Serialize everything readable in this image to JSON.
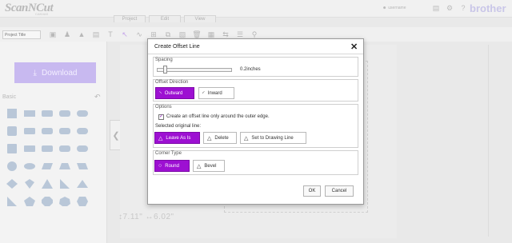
{
  "app": {
    "logo_text": "ScanNCut",
    "logo_sub": "CANVAS",
    "brand": "brother",
    "user_name": "username"
  },
  "tabs": [
    {
      "label": "Project"
    },
    {
      "label": "Edit"
    },
    {
      "label": "View"
    }
  ],
  "toolbar": {
    "project_title_placeholder": "Project Title",
    "icons": [
      "save-icon",
      "person-icon",
      "stamp-icon",
      "image-icon",
      "text-icon",
      "select-cursor-icon",
      "line-tool-icon",
      "crop-icon",
      "copy-icon",
      "paste-icon",
      "delete-icon",
      "grid-icon",
      "flip-icon",
      "layer-icon",
      "zoom-icon"
    ]
  },
  "sidebar": {
    "download_label": "Download",
    "section_label": "Basic"
  },
  "canvas": {
    "dims_text": "↕7.11\"  ↔6.02\""
  },
  "dialog": {
    "title": "Create Offset Line",
    "close_label": "✕",
    "spacing": {
      "label": "Spacing",
      "value_text": "0.2inches",
      "value": 0.2
    },
    "offset_direction": {
      "label": "Offset Direction",
      "outward": "Outward",
      "inward": "Inward",
      "selected": "Outward"
    },
    "options": {
      "label": "Options",
      "checkbox_label": "Create an offset line only around the outer edge.",
      "checkbox_checked": true,
      "selected_original_label": "Selected original line:",
      "leave_as_is": "Leave As Is",
      "delete": "Delete",
      "set_to_drawing": "Set to Drawing Line",
      "selected": "Leave As Is"
    },
    "corner_type": {
      "label": "Corner Type",
      "round": "Round",
      "bevel": "Bevel",
      "selected": "Round"
    },
    "ok_label": "OK",
    "cancel_label": "Cancel"
  },
  "colors": {
    "accent": "#9d10d2",
    "download_button": "#c8b9f0",
    "brand_text": "#c9c6e8"
  }
}
